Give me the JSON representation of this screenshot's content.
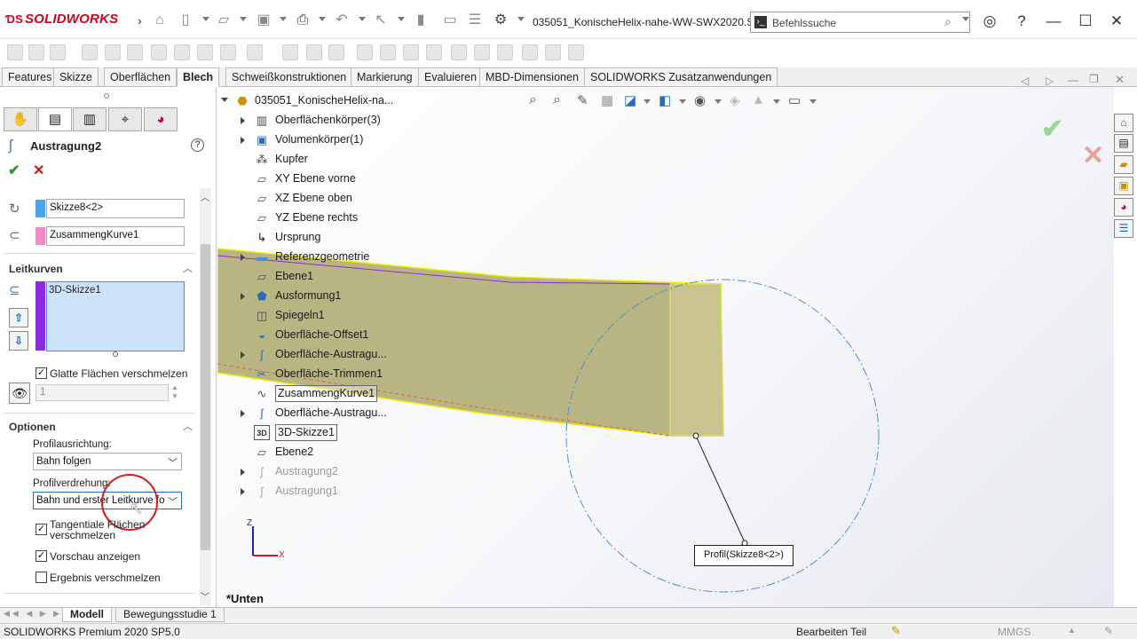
{
  "app": {
    "brand": "SOLIDWORKS",
    "document_title": "035051_KonischeHelix-nahe-WW-SWX2020.S...",
    "command_search_placeholder": "Befehlssuche"
  },
  "tabs": [
    {
      "label": "Features"
    },
    {
      "label": "Skizze"
    },
    {
      "label": "Oberflächen"
    },
    {
      "label": "Blech",
      "active": true
    },
    {
      "label": "Schweißkonstruktionen"
    },
    {
      "label": "Markierung"
    },
    {
      "label": "Evaluieren"
    },
    {
      "label": "MBD-Dimensionen"
    },
    {
      "label": "SOLIDWORKS Zusatzanwendungen"
    }
  ],
  "property_manager": {
    "title": "Austragung2",
    "profile_field": "Skizze8<2>",
    "path_field": "ZusammengKurve1",
    "guide_curves_section": "Leitkurven",
    "guide_curves_list": [
      "3D-Skizze1"
    ],
    "merge_smooth_faces": "Glatte Flächen verschmelzen",
    "spinner_value": "1",
    "options_section": "Optionen",
    "profile_orientation_label": "Profilausrichtung:",
    "profile_orientation_value": "Bahn folgen",
    "profile_twist_label": "Profilverdrehung:",
    "profile_twist_value": "Bahn und erster Leitkurve fo",
    "merge_tangent_faces": "Tangentiale Flächen verschmelzen",
    "show_preview": "Vorschau anzeigen",
    "merge_result": "Ergebnis verschmelzen"
  },
  "feature_tree": {
    "root": "035051_KonischeHelix-na...",
    "items": [
      {
        "label": "Oberflächenkörper(3)",
        "icon": "surface-bodies-icon",
        "expandable": true
      },
      {
        "label": "Volumenkörper(1)",
        "icon": "solid-bodies-icon",
        "expandable": true
      },
      {
        "label": "Kupfer",
        "icon": "material-icon",
        "expandable": false
      },
      {
        "label": "XY Ebene vorne",
        "icon": "plane-icon",
        "expandable": false
      },
      {
        "label": "XZ Ebene oben",
        "icon": "plane-icon",
        "expandable": false
      },
      {
        "label": "YZ Ebene rechts",
        "icon": "plane-icon",
        "expandable": false
      },
      {
        "label": "Ursprung",
        "icon": "origin-icon",
        "expandable": false
      },
      {
        "label": "Referenzgeometrie",
        "icon": "folder-icon",
        "expandable": true
      },
      {
        "label": "Ebene1",
        "icon": "plane-icon",
        "expandable": false
      },
      {
        "label": "Ausformung1",
        "icon": "loft-icon",
        "expandable": true
      },
      {
        "label": "Spiegeln1",
        "icon": "mirror-icon",
        "expandable": false
      },
      {
        "label": "Oberfläche-Offset1",
        "icon": "offset-surface-icon",
        "expandable": false
      },
      {
        "label": "Oberfläche-Austragu...",
        "icon": "sweep-surface-icon",
        "expandable": true
      },
      {
        "label": "Oberfläche-Trimmen1",
        "icon": "trim-surface-icon",
        "expandable": false
      },
      {
        "label": "ZusammengKurve1",
        "icon": "composite-curve-icon",
        "expandable": false,
        "highlight": true
      },
      {
        "label": "Oberfläche-Austragu...",
        "icon": "sweep-surface-icon",
        "expandable": true
      },
      {
        "label": "3D-Skizze1",
        "icon": "sketch3d-icon",
        "expandable": false,
        "highlight": true
      },
      {
        "label": "Ebene2",
        "icon": "plane-icon",
        "expandable": false
      },
      {
        "label": "Austragung2",
        "icon": "sweep-icon",
        "expandable": true,
        "dim": true
      },
      {
        "label": "Austragung1",
        "icon": "sweep-icon",
        "expandable": true,
        "dim": true
      }
    ]
  },
  "viewport": {
    "view_name": "*Unten",
    "callout": "Profil(Skizze8<2>)",
    "triad_z": "Z",
    "triad_x": "X"
  },
  "bottom_tabs": [
    {
      "label": "Modell",
      "active": true
    },
    {
      "label": "Bewegungsstudie 1"
    }
  ],
  "status": {
    "product": "SOLIDWORKS Premium 2020 SP5.0",
    "mode": "Bearbeiten Teil",
    "units": "MMGS"
  },
  "colors": {
    "brand_red": "#d6001c",
    "profile_swatch": "#4aa3f0",
    "path_swatch": "#f08ac8",
    "guide_swatch": "#8a2be2",
    "selection_blue": "#cde3fa"
  }
}
